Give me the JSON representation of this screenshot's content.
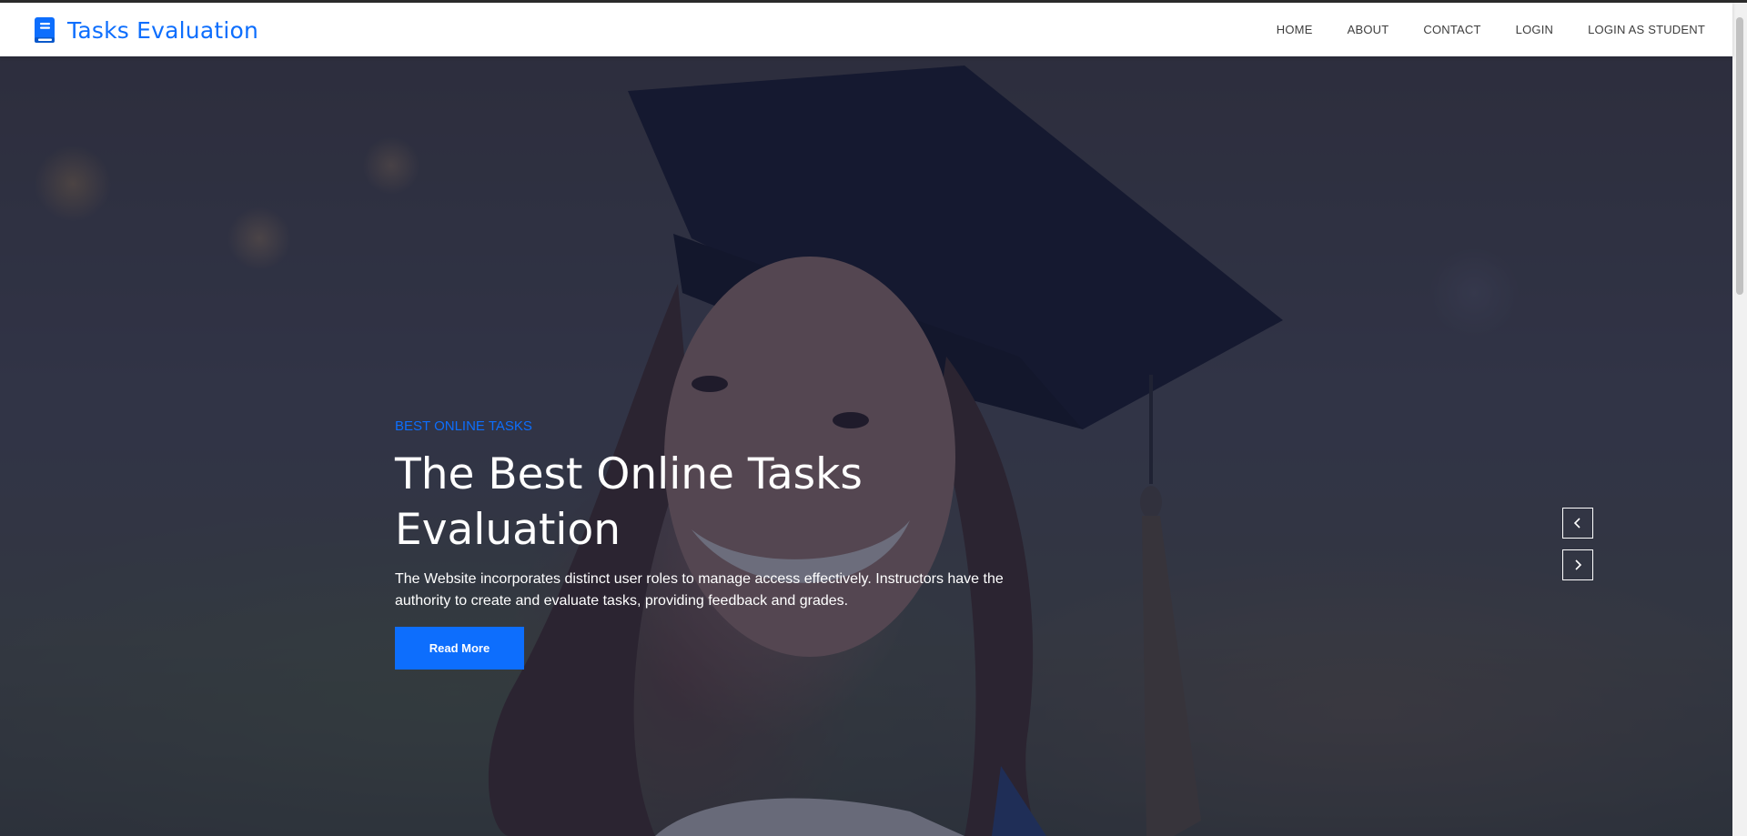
{
  "brand": {
    "name": "Tasks Evaluation",
    "icon": "book-icon",
    "color": "#0d6efd"
  },
  "nav": {
    "items": [
      {
        "label": "HOME"
      },
      {
        "label": "ABOUT"
      },
      {
        "label": "CONTACT"
      },
      {
        "label": "LOGIN"
      },
      {
        "label": "LOGIN AS STUDENT"
      }
    ]
  },
  "hero": {
    "eyebrow": "BEST ONLINE TASKS",
    "headline": "The Best Online Tasks Evaluation",
    "description": "The Website incorporates distinct user roles to manage access effectively. Instructors have the authority to create and evaluate tasks, providing feedback and grades.",
    "cta_label": "Read More",
    "background_image": "graduate-portrait-photo",
    "overlay_color": "#181d38"
  },
  "carousel": {
    "prev_icon": "chevron-left-icon",
    "next_icon": "chevron-right-icon"
  }
}
